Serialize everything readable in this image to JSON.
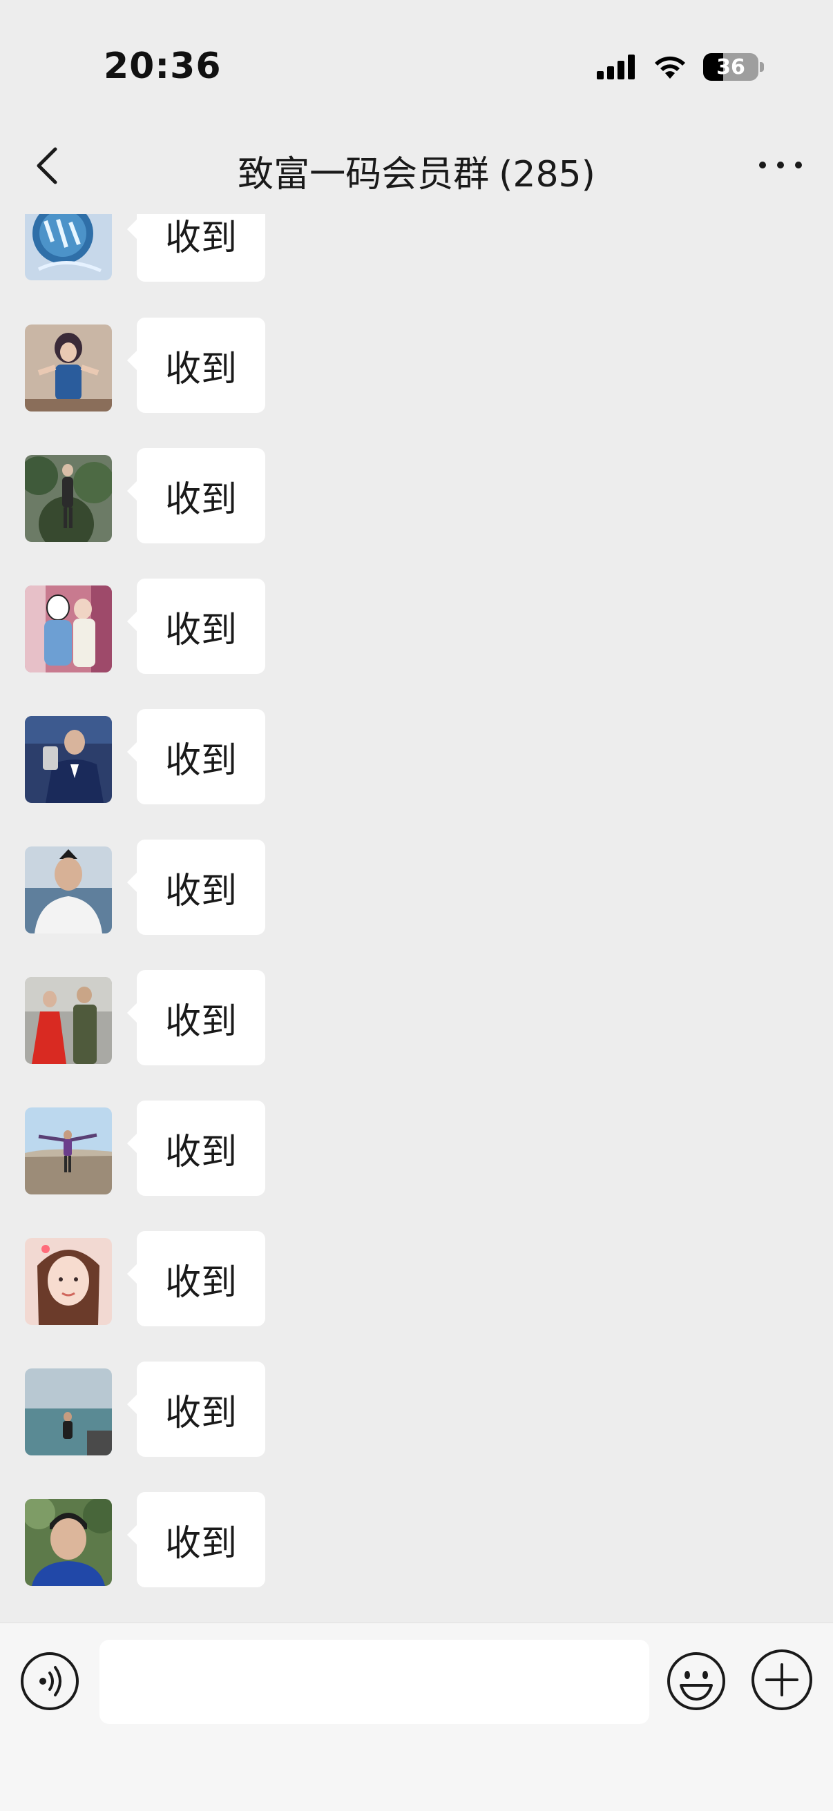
{
  "status_bar": {
    "time": "20:36",
    "battery": "36",
    "signal_icon": "cellular-signal-icon",
    "wifi_icon": "wifi-icon",
    "battery_icon": "battery-icon"
  },
  "nav": {
    "title": "致富一码会员群",
    "member_count": "(285)",
    "back_icon": "chevron-left-icon",
    "more_icon": "more-dots-icon"
  },
  "messages": [
    {
      "text": "收到",
      "avatar": "avatar-blue-text-logo"
    },
    {
      "text": "收到",
      "avatar": "avatar-woman-blue-dress"
    },
    {
      "text": "收到",
      "avatar": "avatar-person-forest"
    },
    {
      "text": "收到",
      "avatar": "avatar-couple-cartoon"
    },
    {
      "text": "收到",
      "avatar": "avatar-man-suit-trophy"
    },
    {
      "text": "收到",
      "avatar": "avatar-man-white-shirt"
    },
    {
      "text": "收到",
      "avatar": "avatar-couple-wedding"
    },
    {
      "text": "收到",
      "avatar": "avatar-man-mountain-top"
    },
    {
      "text": "收到",
      "avatar": "avatar-woman-selfie"
    },
    {
      "text": "收到",
      "avatar": "avatar-person-sea-view"
    },
    {
      "text": "收到",
      "avatar": "avatar-man-trees"
    }
  ],
  "input_bar": {
    "placeholder": "",
    "voice_icon": "voice-icon",
    "emoji_icon": "emoji-icon",
    "plus_icon": "plus-icon"
  },
  "colors": {
    "background": "#ededed",
    "bubble": "#ffffff",
    "input_bar": "#f6f6f6"
  }
}
